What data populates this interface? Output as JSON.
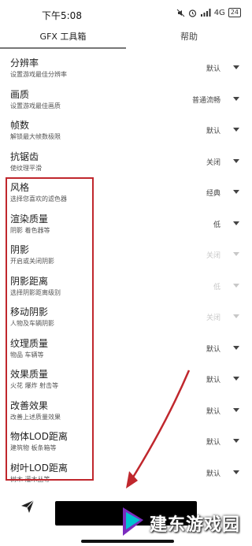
{
  "status_bar": {
    "time": "下午5:08",
    "network": "4G",
    "battery": "24"
  },
  "tabs": [
    {
      "label": "GFX 工具箱",
      "active": true
    },
    {
      "label": "帮助",
      "active": false
    }
  ],
  "settings": [
    {
      "title": "分辨率",
      "desc": "设置游戏最佳分辨率",
      "value": "默认",
      "disabled": false
    },
    {
      "title": "画质",
      "desc": "设置游戏最佳画质",
      "value": "普通流畅",
      "disabled": false
    },
    {
      "title": "帧数",
      "desc": "解锁最大帧数极限",
      "value": "默认",
      "disabled": false
    },
    {
      "title": "抗锯齿",
      "desc": "使纹理平滑",
      "value": "关闭",
      "disabled": false
    },
    {
      "title": "风格",
      "desc": "选择您喜欢的滤色器",
      "value": "经典",
      "disabled": false
    },
    {
      "title": "渲染质量",
      "desc": "阴影 着色器等",
      "value": "低",
      "disabled": false
    },
    {
      "title": "阴影",
      "desc": "开启或关闭阴影",
      "value": "关闭",
      "disabled": true
    },
    {
      "title": "阴影距离",
      "desc": "选择阴影距离级别",
      "value": "低",
      "disabled": true
    },
    {
      "title": "移动阴影",
      "desc": "人物及车辆阴影",
      "value": "关闭",
      "disabled": true
    },
    {
      "title": "纹理质量",
      "desc": "物品 车辆等",
      "value": "默认",
      "disabled": false
    },
    {
      "title": "效果质量",
      "desc": "火花 爆炸 射击等",
      "value": "默认",
      "disabled": false
    },
    {
      "title": "改善效果",
      "desc": "改善上述质量效果",
      "value": "默认",
      "disabled": false
    },
    {
      "title": "物体LOD距离",
      "desc": "建筑物 板条箱等",
      "value": "默认",
      "disabled": false
    },
    {
      "title": "树叶LOD距离",
      "desc": "树木 灌木丛等",
      "value": "默认",
      "disabled": false
    }
  ],
  "watermark": {
    "text": "建东游戏园"
  },
  "colors": {
    "highlight": "#c0272d",
    "disabled_text": "#c8c8c8"
  },
  "icons": {
    "send": "send-icon"
  }
}
